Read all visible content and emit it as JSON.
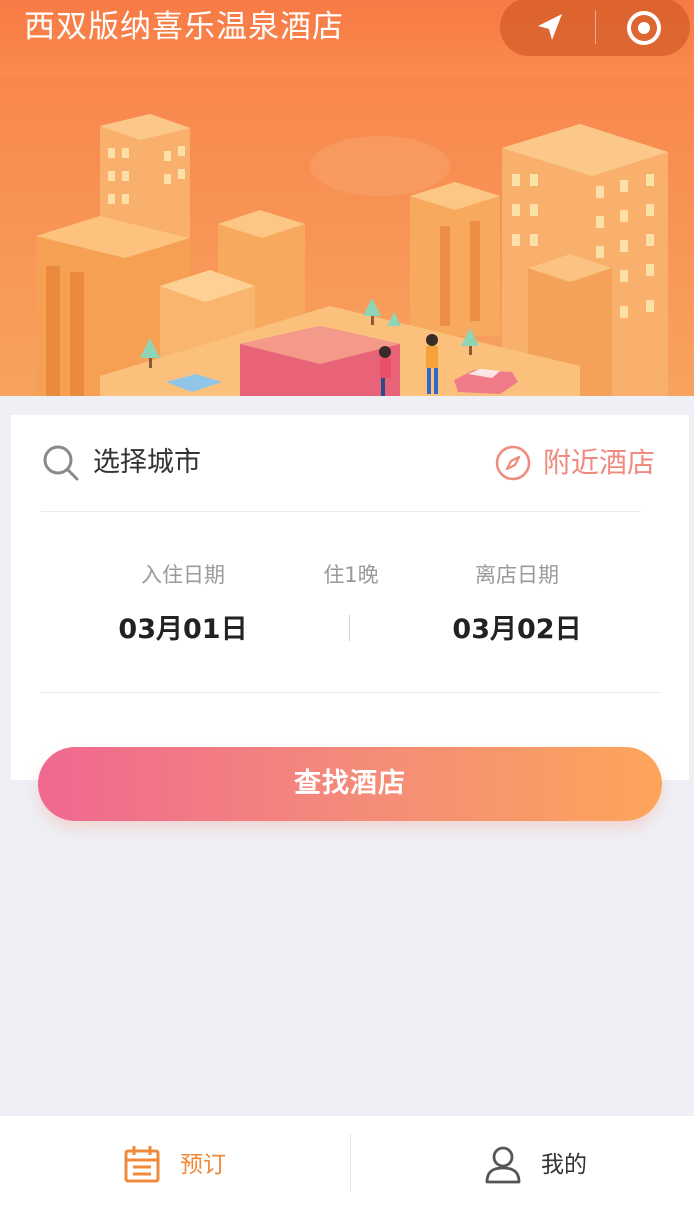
{
  "header": {
    "title": "西双版纳喜乐温泉酒店",
    "nav_icon": "navigation-arrow-icon",
    "target_icon": "target-icon"
  },
  "search": {
    "city_placeholder": "选择城市",
    "nearby_label": "附近酒店"
  },
  "dates": {
    "checkin_label": "入住日期",
    "checkin_value": "03月01日",
    "nights_label": "住1晚",
    "checkout_label": "离店日期",
    "checkout_value": "03月02日"
  },
  "search_button": "查找酒店",
  "tabbar": {
    "tabs": [
      {
        "label": "预订",
        "icon": "calendar-icon",
        "active": true
      },
      {
        "label": "我的",
        "icon": "user-icon",
        "active": false
      }
    ]
  },
  "colors": {
    "brand_orange": "#f77a45",
    "accent_pink": "#ef6890",
    "active_tab": "#f0893a"
  }
}
